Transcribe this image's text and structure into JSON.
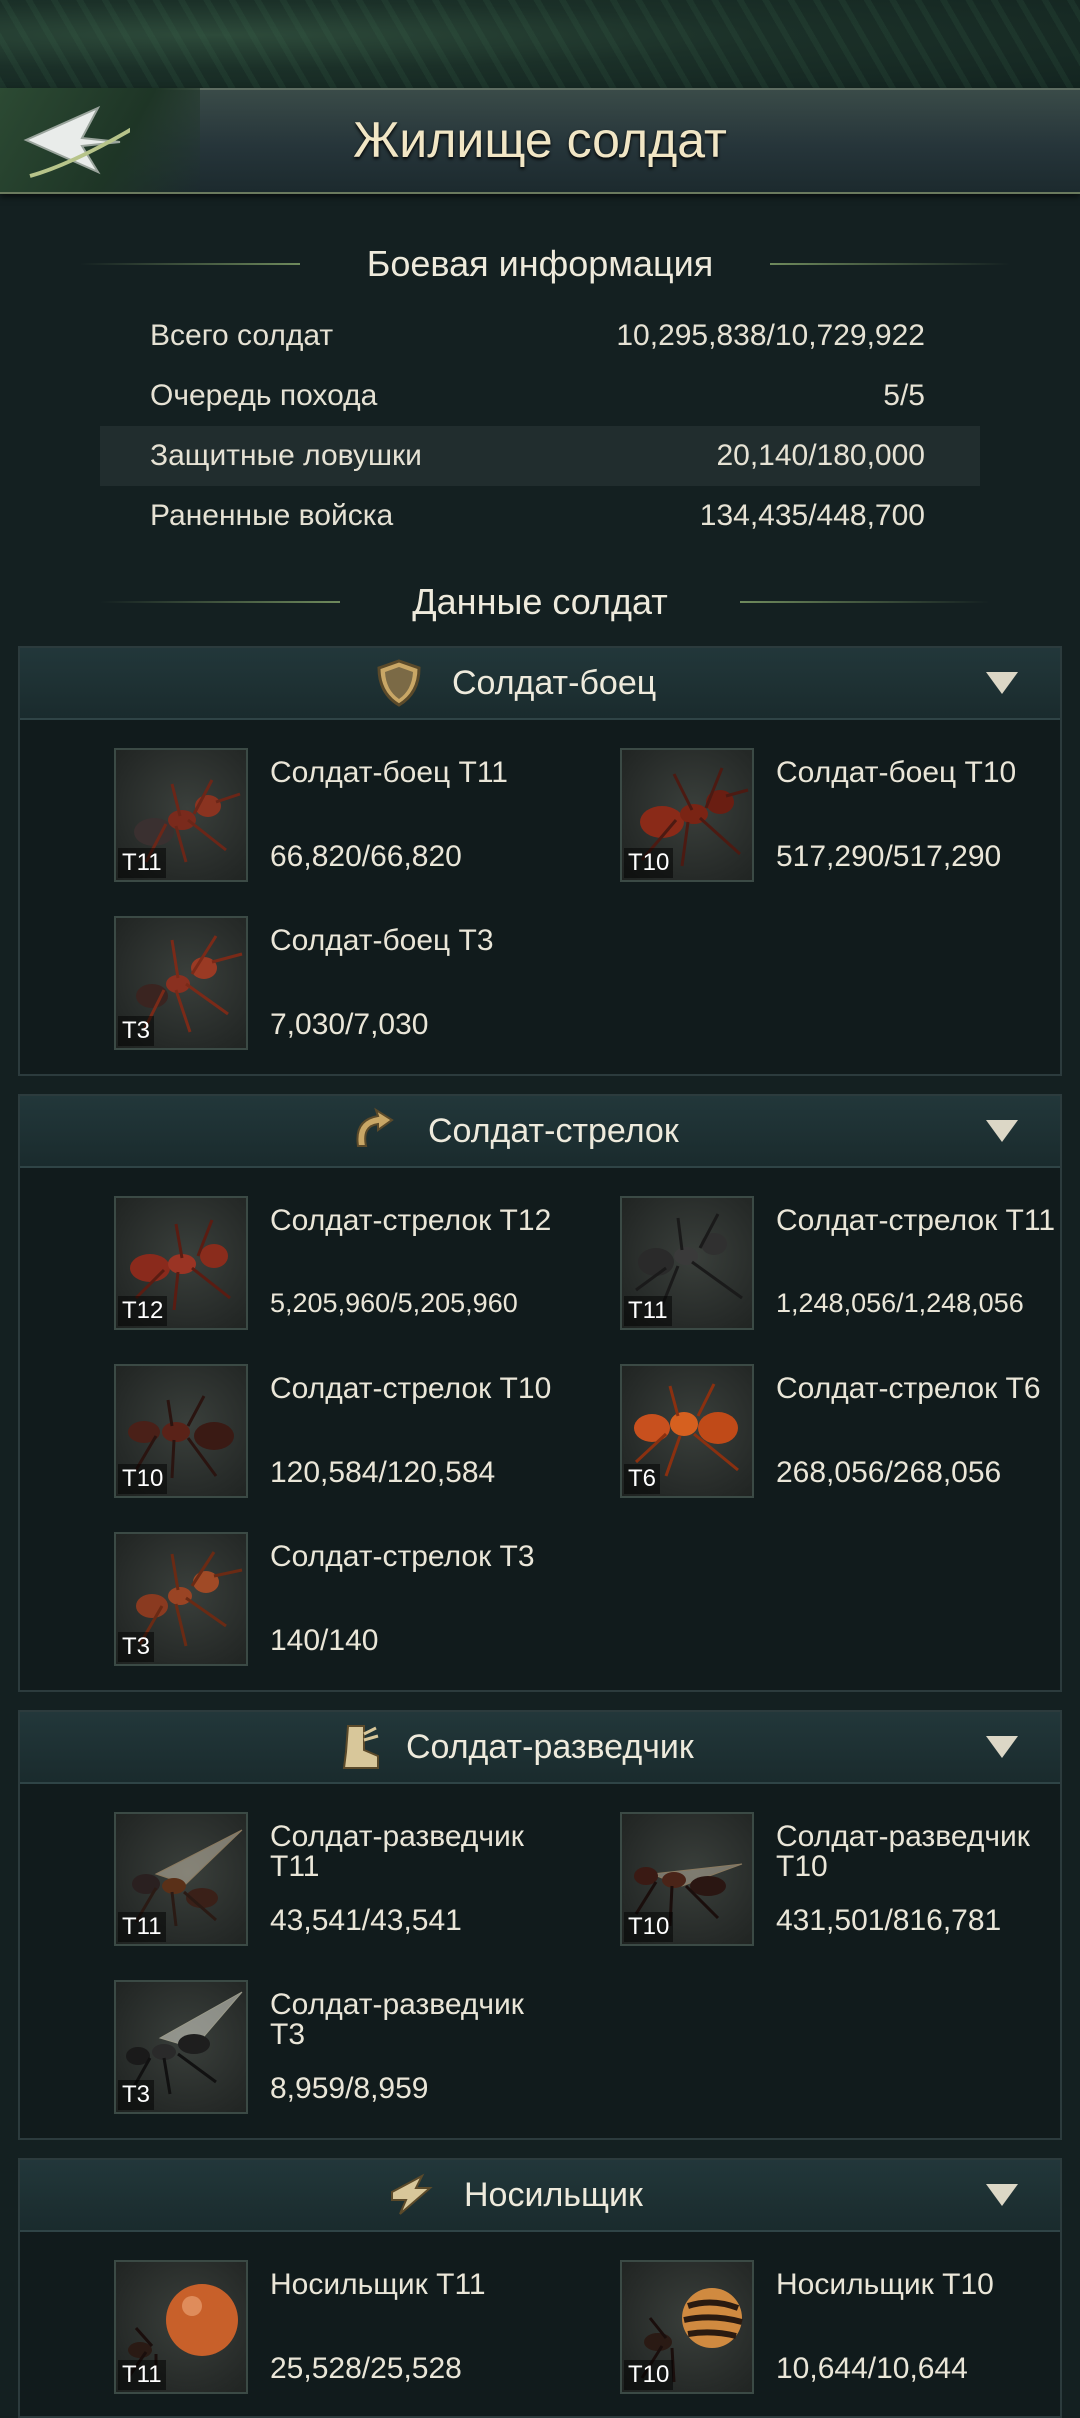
{
  "header": {
    "title": "Жилище солдат",
    "back_icon": "arrow-left-icon"
  },
  "battle_info": {
    "title": "Боевая информация",
    "rows": [
      {
        "label": "Всего солдат",
        "value": "10,295,838/10,729,922"
      },
      {
        "label": "Очередь похода",
        "value": "5/5"
      },
      {
        "label": "Защитные ловушки",
        "value": "20,140/180,000"
      },
      {
        "label": "Раненные войска",
        "value": "134,435/448,700"
      }
    ]
  },
  "soldier_data": {
    "title": "Данные солдат",
    "categories": [
      {
        "label": "Солдат-боец",
        "icon": "shield-icon",
        "units": [
          {
            "name": "Солдат-боец T11",
            "count": "66,820/66,820",
            "tier": "T11"
          },
          {
            "name": "Солдат-боец T10",
            "count": "517,290/517,290",
            "tier": "T10"
          },
          {
            "name": "Солдат-боец T3",
            "count": "7,030/7,030",
            "tier": "T3"
          }
        ]
      },
      {
        "label": "Солдат-стрелок",
        "icon": "curved-arrow-icon",
        "units": [
          {
            "name": "Солдат-стрелок T12",
            "count": "5,205,960/5,205,960",
            "tier": "T12"
          },
          {
            "name": "Солдат-стрелок T11",
            "count": "1,248,056/1,248,056",
            "tier": "T11"
          },
          {
            "name": "Солдат-стрелок T10",
            "count": "120,584/120,584",
            "tier": "T10"
          },
          {
            "name": "Солдат-стрелок T6",
            "count": "268,056/268,056",
            "tier": "T6"
          },
          {
            "name": "Солдат-стрелок T3",
            "count": "140/140",
            "tier": "T3"
          }
        ]
      },
      {
        "label": "Солдат-разведчик",
        "icon": "boot-icon",
        "units": [
          {
            "name": "Солдат-разведчик T11",
            "count": "43,541/43,541",
            "tier": "T11"
          },
          {
            "name": "Солдат-разведчик T10",
            "count": "431,501/816,781",
            "tier": "T10"
          },
          {
            "name": "Солдат-разведчик T3",
            "count": "8,959/8,959",
            "tier": "T3"
          }
        ]
      },
      {
        "label": "Носильщик",
        "icon": "lightning-icon",
        "units": [
          {
            "name": "Носильщик T11",
            "count": "25,528/25,528",
            "tier": "T11"
          },
          {
            "name": "Носильщик T10",
            "count": "10,644/10,644",
            "tier": "T10"
          }
        ]
      }
    ]
  }
}
